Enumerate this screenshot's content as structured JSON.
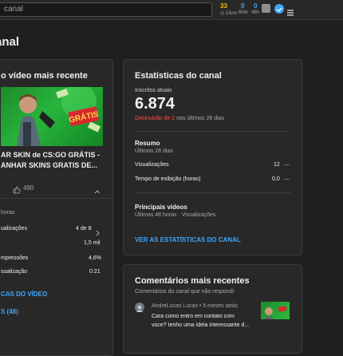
{
  "topbar": {
    "search_placeholder": "canal",
    "stats": [
      {
        "value": "33",
        "label": "1Ano",
        "color": "#f9c300"
      },
      {
        "value": "0",
        "label": "60m",
        "color": "#3ea6ff"
      },
      {
        "value": "0",
        "label": "48h",
        "color": "#3ea6ff"
      }
    ]
  },
  "page": {
    "title": "anal"
  },
  "latest_video": {
    "card_title": "o vídeo mais recente",
    "thumbnail_badge": "GRÁTIS",
    "video_title_line1": "AR SKIN de CS:GO GRÁTIS -",
    "video_title_line2": "ANHAR SKINS GRATIS DE...",
    "likes": "490",
    "period": "horas",
    "rows": [
      {
        "label": "ualizações",
        "value": "4 de 8"
      },
      {
        "label": "",
        "value": "1,5 mil"
      },
      {
        "label": "mpressões",
        "value": "4,6%"
      },
      {
        "label": "sualização",
        "value": "0:21"
      }
    ],
    "link_video_stats": "CAS DO VÍDEO",
    "link_comments": "S (48)"
  },
  "channel_stats": {
    "title": "Estatísticas do canal",
    "subscribers_label": "Inscritos atuais",
    "subscribers_value": "6.874",
    "change_red": "Diminuição de 2",
    "change_rest": " nos últimos 28 dias",
    "summary_title": "Resumo",
    "summary_period": "Últimos 28 dias",
    "summary_rows": [
      {
        "label": "Visualizações",
        "value": "12",
        "trend": "—"
      },
      {
        "label": "Tempo de exibição (horas)",
        "value": "0,0",
        "trend": "—"
      }
    ],
    "top_videos_title": "Principais vídeos",
    "top_videos_sub": "Últimas 48 horas · Visualizações",
    "link": "VER AS ESTATÍSTICAS DO CANAL"
  },
  "comments": {
    "title": "Comentários mais recentes",
    "subtitle": "Comentários do canal que não respondi",
    "author": "AndreLucas Lucas",
    "time": " • 5 meses atrás",
    "text_line1": "Cara  como entro em contato com",
    "text_line2": "voce? tenho  uma ideia interessante d..."
  },
  "colors": {
    "accent": "#3ea6ff",
    "negative": "#ff4e45",
    "card": "#282828",
    "background": "#1f1f1f"
  }
}
